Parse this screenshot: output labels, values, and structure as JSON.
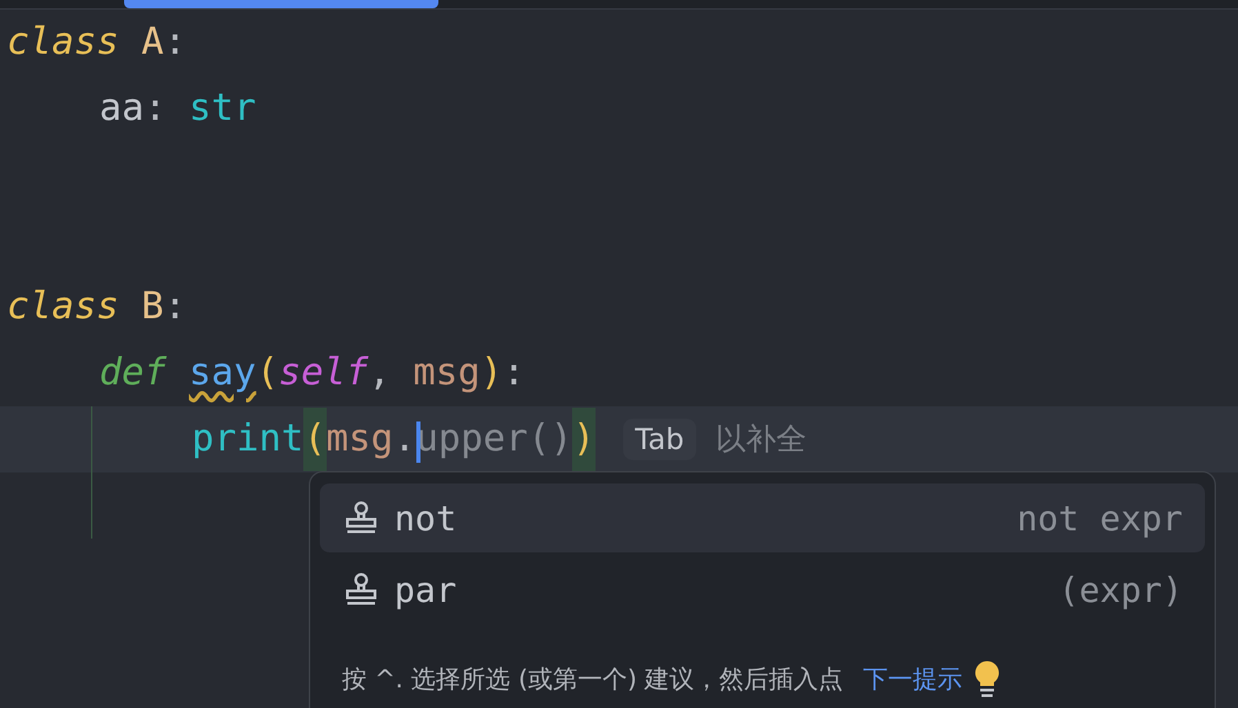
{
  "code": [
    {
      "tokens": [
        {
          "kind": "keyword",
          "text": "class "
        },
        {
          "kind": "classname",
          "text": "A"
        },
        {
          "kind": "punct",
          "text": ":"
        }
      ],
      "children": [
        {
          "tokens": [
            {
              "kind": "field",
              "text": "aa"
            },
            {
              "kind": "punct",
              "text": ": "
            },
            {
              "kind": "builtin",
              "text": "str"
            }
          ]
        }
      ]
    },
    {
      "tokens": [
        {
          "kind": "keyword",
          "text": "class "
        },
        {
          "kind": "classname",
          "text": "B"
        },
        {
          "kind": "punct",
          "text": ":"
        }
      ],
      "children": [
        {
          "tokens": [
            {
              "kind": "defkw",
              "text": "def "
            },
            {
              "kind": "func",
              "text": "say",
              "warning": true
            },
            {
              "kind": "paren",
              "text": "("
            },
            {
              "kind": "self",
              "text": "self"
            },
            {
              "kind": "punct",
              "text": ", "
            },
            {
              "kind": "param",
              "text": "msg"
            },
            {
              "kind": "paren",
              "text": ")"
            },
            {
              "kind": "punct",
              "text": ":"
            }
          ],
          "children": [
            {
              "current": true,
              "tokens": [
                {
                  "kind": "builtin",
                  "text": "print"
                },
                {
                  "kind": "paren",
                  "text": "(",
                  "matched": true
                },
                {
                  "kind": "param",
                  "text": "msg"
                },
                {
                  "kind": "punct",
                  "text": "."
                },
                {
                  "kind": "ghost",
                  "text": "upper()",
                  "caret": true
                },
                {
                  "kind": "paren",
                  "text": ")",
                  "matched": true
                }
              ],
              "hint": {
                "key": "Tab",
                "text": "以补全"
              }
            }
          ]
        }
      ]
    }
  ],
  "completion_popup": {
    "items": [
      {
        "name": "not",
        "detail": "not expr",
        "selected": true
      },
      {
        "name": "par",
        "detail": "(expr)",
        "selected": false
      }
    ],
    "footer": "按 ^. 选择所选 (或第一个) 建议，然后插入点",
    "footer_link": "下一提示"
  }
}
